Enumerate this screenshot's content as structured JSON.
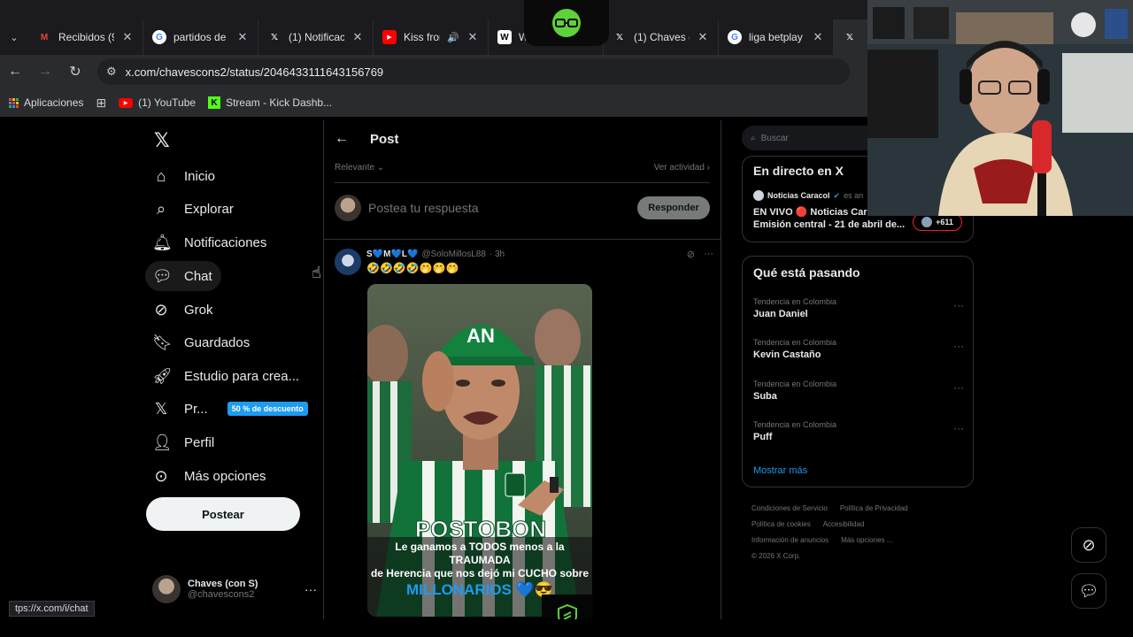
{
  "tabs": [
    {
      "label": "Recibidos (9",
      "icon": "gmail-icon",
      "color": "#ea4335"
    },
    {
      "label": "partidos de l",
      "icon": "google-icon",
      "color": "#4285f4"
    },
    {
      "label": "(1) Notificaci",
      "icon": "x-icon",
      "color": "#ffffff"
    },
    {
      "label": "Kiss from",
      "icon": "youtube-icon",
      "color": "#ff0000"
    },
    {
      "label": "Wa",
      "icon": "wikipedia-icon",
      "color": "#ffffff"
    },
    {
      "label": "(1) Chaves (c",
      "icon": "x-icon",
      "color": "#ffffff"
    },
    {
      "label": "liga betplay",
      "icon": "google-icon",
      "color": "#4285f4"
    },
    {
      "label": "C",
      "icon": "x-icon",
      "color": "#ffffff"
    }
  ],
  "address": {
    "url": "x.com/chavescons2/status/2046433111643156769"
  },
  "bookmarks": [
    {
      "label": "Aplicaciones",
      "icon": "apps-grid-icon"
    },
    {
      "label": "",
      "icon": "tab-grid-icon"
    },
    {
      "label": "(1) YouTube",
      "icon": "youtube-icon"
    },
    {
      "label": "Stream - Kick Dashb...",
      "icon": "kick-icon"
    }
  ],
  "nav": {
    "items": [
      {
        "label": "Inicio",
        "icon": "home-icon"
      },
      {
        "label": "Explorar",
        "icon": "search-icon"
      },
      {
        "label": "Notificaciones",
        "icon": "bell-icon"
      },
      {
        "label": "Chat",
        "icon": "chat-icon"
      },
      {
        "label": "Grok",
        "icon": "grok-icon"
      },
      {
        "label": "Guardados",
        "icon": "bookmark-icon"
      },
      {
        "label": "Estudio para crea...",
        "icon": "rocket-icon"
      },
      {
        "label": "Pr...",
        "icon": "x-premium-icon",
        "badge": "50 % de descuento"
      },
      {
        "label": "Perfil",
        "icon": "person-icon"
      },
      {
        "label": "Más opciones",
        "icon": "more-circle-icon"
      }
    ],
    "post_button": "Postear",
    "account": {
      "name": "Chaves (con S)",
      "handle": "@chavescons2"
    }
  },
  "main": {
    "title": "Post",
    "sort_label": "Relevante",
    "activity_label": "Ver actividad",
    "reply_placeholder": "Postea tu respuesta",
    "reply_button": "Responder",
    "tweet": {
      "name": "S💙M💙L💙",
      "handle": "@SoloMillosL88",
      "time": "· 3h",
      "text": "🤣🤣🤣🤣🤭🤭🤭",
      "image_caption": {
        "line1": "Le ganamos a TODOS menos a la TRAUMADA",
        "line2": "de Herencia que nos dejó mi CUCHO sobre",
        "line3": "MILLONARIOS 💙😎"
      },
      "jersey_text": "POSTOBON",
      "cap_text": "AN"
    }
  },
  "right": {
    "search_placeholder": "Buscar",
    "live": {
      "title": "En directo en X",
      "source": "Noticias Caracol",
      "source_suffix": "es an",
      "text": "EN VIVO 🔴 Noticias Caracol - Emisión central - 21 de abril de...",
      "count": "+611"
    },
    "trends_title": "Qué está pasando",
    "trends": [
      {
        "context": "Tendencia en Colombia",
        "name": "Juan Daniel"
      },
      {
        "context": "Tendencia en Colombia",
        "name": "Kevin Castaño"
      },
      {
        "context": "Tendencia en Colombia",
        "name": "Suba"
      },
      {
        "context": "Tendencia en Colombia",
        "name": "Puff"
      }
    ],
    "show_more": "Mostrar más",
    "footer": [
      "Condiciones de Servicio",
      "Política de Privacidad",
      "Política de cookies",
      "Accesibilidad",
      "Información de anuncios",
      "Más opciones ...",
      "© 2026 X Corp."
    ]
  },
  "status_url": "tps://x.com/i/chat",
  "colors": {
    "accent": "#1d9bf0",
    "background": "#000000",
    "border": "#2f3336",
    "live": "#f4212e"
  }
}
